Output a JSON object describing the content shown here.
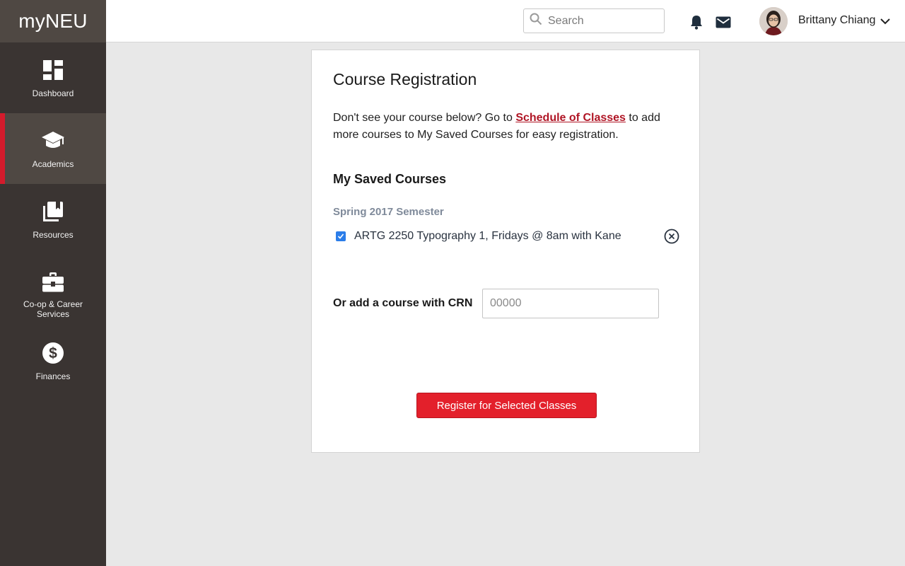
{
  "app": {
    "brand": "myNEU"
  },
  "sidebar": {
    "items": [
      {
        "label": "Dashboard",
        "icon": "dashboard-icon",
        "active": false
      },
      {
        "label": "Academics",
        "icon": "graduation-cap-icon",
        "active": true
      },
      {
        "label": "Resources",
        "icon": "books-icon",
        "active": false
      },
      {
        "label": "Co-op & Career Services",
        "icon": "briefcase-icon",
        "active": false
      },
      {
        "label": "Finances",
        "icon": "dollar-icon",
        "active": false
      }
    ]
  },
  "header": {
    "search_placeholder": "Search",
    "user_name": "Brittany Chiang",
    "icons": [
      "bell-icon",
      "mail-icon",
      "chevron-down-icon"
    ]
  },
  "registration": {
    "title": "Course Registration",
    "intro_before": "Don't see your course below? Go to ",
    "intro_link": "Schedule of Classes",
    "intro_after": " to add more courses to My Saved Courses for easy registration.",
    "saved_title": "My Saved Courses",
    "semester": "Spring 2017 Semester",
    "courses": [
      {
        "label": "ARTG 2250 Typography 1, Fridays @ 8am with Kane",
        "checked": true
      }
    ],
    "crn_label": "Or add a course with CRN",
    "crn_placeholder": "00000",
    "crn_value": "",
    "register_label": "Register for Selected Classes"
  },
  "colors": {
    "sidebar_bg": "#3a3432",
    "sidebar_active_bg": "#4f4843",
    "accent_red": "#e3202b",
    "link_red": "#b01525",
    "checkbox_blue": "#2b7de9",
    "semester_gray": "#7f8a9a"
  }
}
